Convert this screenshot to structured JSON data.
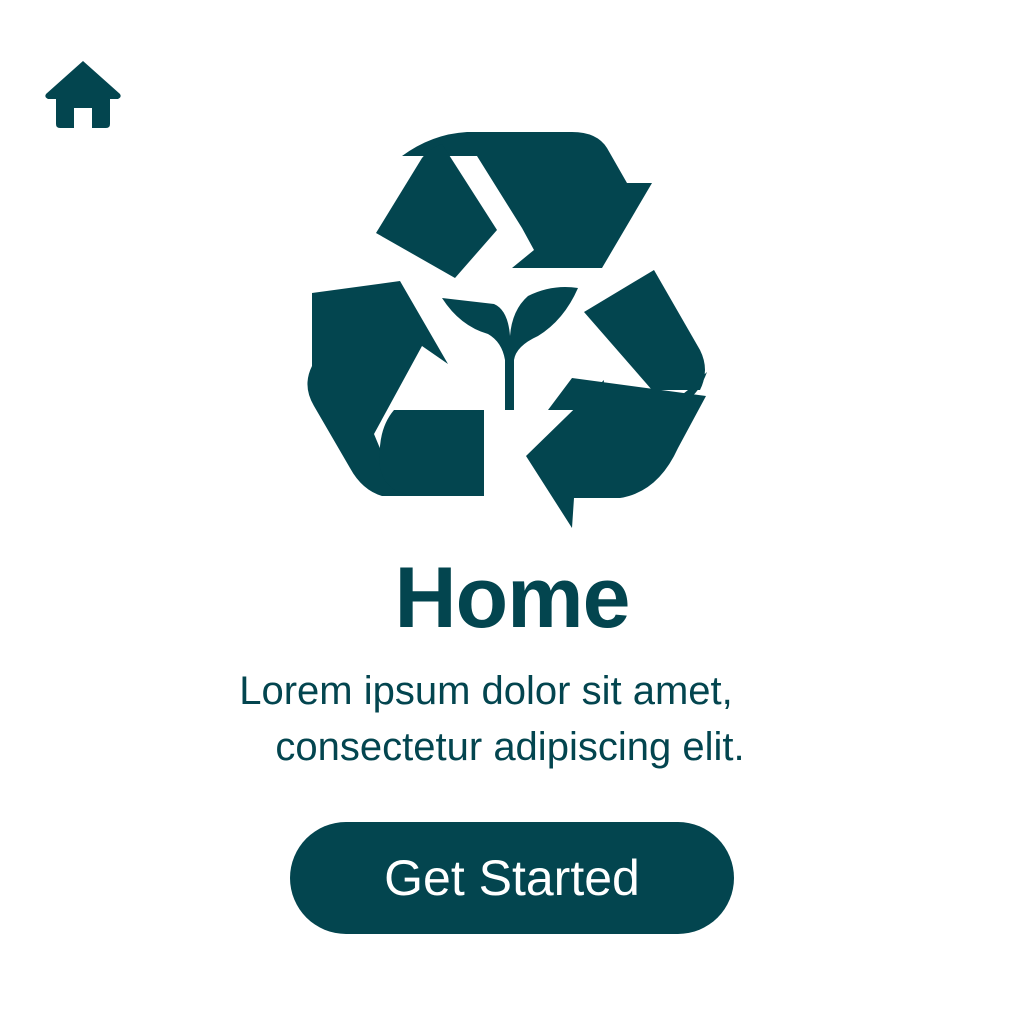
{
  "colors": {
    "primary": "#03454f",
    "background": "#ffffff",
    "button_text": "#ffffff"
  },
  "nav": {
    "home_icon": "home-icon"
  },
  "hero": {
    "logo_icon": "recycle-sprout-icon"
  },
  "main": {
    "title": "Home",
    "description_lines": [
      "Lorem ipsum dolor sit amet,",
      "consectetur adipiscing elit."
    ],
    "cta_label": "Get Started"
  }
}
